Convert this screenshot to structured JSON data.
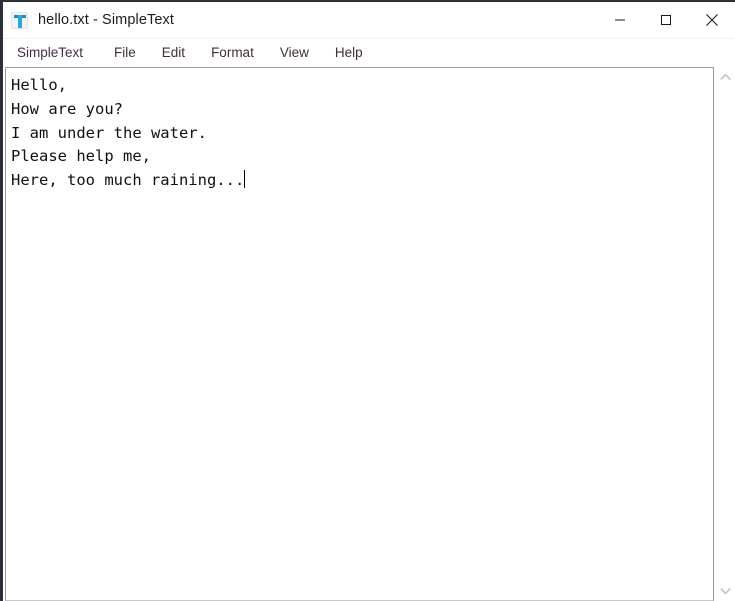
{
  "window": {
    "title": "hello.txt - SimpleText",
    "icon": "text-document-icon",
    "controls": {
      "minimize": "minimize-button",
      "maximize": "maximize-button",
      "close": "close-button"
    }
  },
  "menu": {
    "items": [
      {
        "label": "SimpleText",
        "name": "menu-item-simpletext",
        "app": true
      },
      {
        "label": "File",
        "name": "menu-item-file",
        "app": false
      },
      {
        "label": "Edit",
        "name": "menu-item-edit",
        "app": false
      },
      {
        "label": "Format",
        "name": "menu-item-format",
        "app": false
      },
      {
        "label": "View",
        "name": "menu-item-view",
        "app": false
      },
      {
        "label": "Help",
        "name": "menu-item-help",
        "app": false
      }
    ]
  },
  "editor": {
    "lines": [
      "Hello,",
      "How are you?",
      "I am under the water.",
      "Please help me,",
      "Here, too much raining..."
    ],
    "text": "Hello,\nHow are you?\nI am under the water.\nPlease help me,\nHere, too much raining...",
    "caret_visible": true
  },
  "scrollbar": {
    "up_arrow": "scroll-up-arrow-icon",
    "down_arrow": "scroll-down-arrow-icon"
  },
  "colors": {
    "title_text": "#1c1c1c",
    "menu_text": "#3f2d3c",
    "icon_blue": "#29a8e0",
    "window_border": "#2b2f38",
    "text_body": "#111111",
    "pane_border": "#9a9a9a"
  }
}
